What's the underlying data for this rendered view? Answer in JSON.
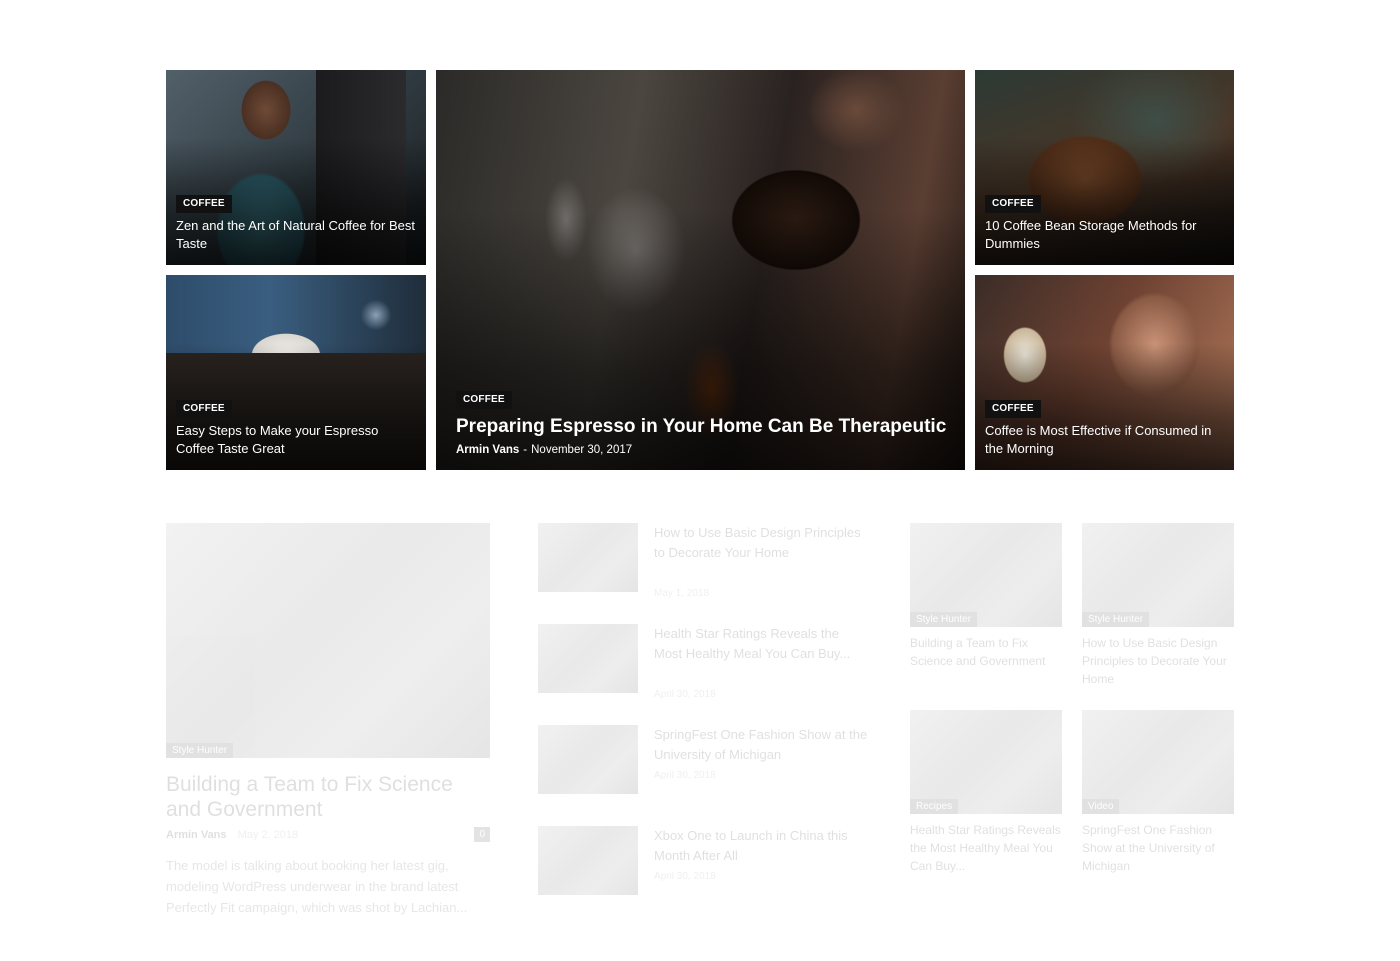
{
  "featured": {
    "tiles": [
      {
        "category": "COFFEE",
        "title": "Zen and the Art of Natural Coffee for Best Taste"
      },
      {
        "category": "COFFEE",
        "title": "Easy Steps to Make your Espresso Coffee Taste Great"
      },
      {
        "category": "COFFEE",
        "title": "10 Coffee Bean Storage Methods for Dummies"
      },
      {
        "category": "COFFEE",
        "title": "Coffee is Most Effective if Consumed in the Morning"
      }
    ],
    "main": {
      "category": "COFFEE",
      "title": "Preparing Espresso in Your Home Can Be Therapeutic",
      "author": "Armin Vans",
      "separator": "-",
      "date": "November 30, 2017"
    }
  },
  "lower": {
    "lead": {
      "category": "Style Hunter",
      "title": "Building a Team to Fix Science and Government",
      "author": "Armin Vans",
      "date": "May 2, 2018",
      "comments": "0",
      "excerpt": "The model is talking about booking her latest gig, modeling WordPress underwear in the brand latest Perfectly Fit campaign, which was shot by Lachian..."
    },
    "list": [
      {
        "title": "How to Use Basic Design Principles to Decorate Your Home",
        "date": "May 1, 2018"
      },
      {
        "title": "Health Star Ratings Reveals the Most Healthy Meal You Can Buy...",
        "date": "April 30, 2018"
      },
      {
        "title": "SpringFest One Fashion Show at the University of Michigan",
        "date": "April 30, 2018"
      },
      {
        "title": "Xbox One to Launch in China this Month After All",
        "date": "April 30, 2018"
      }
    ],
    "grid": [
      {
        "category": "Style Hunter",
        "title": "Building a Team to Fix Science and Government"
      },
      {
        "category": "Style Hunter",
        "title": "How to Use Basic Design Principles to Decorate Your Home"
      },
      {
        "category": "Recipes",
        "title": "Health Star Ratings Reveals the Most Healthy Meal You Can Buy..."
      },
      {
        "category": "Video",
        "title": "SpringFest One Fashion Show at the University of Michigan"
      }
    ]
  }
}
